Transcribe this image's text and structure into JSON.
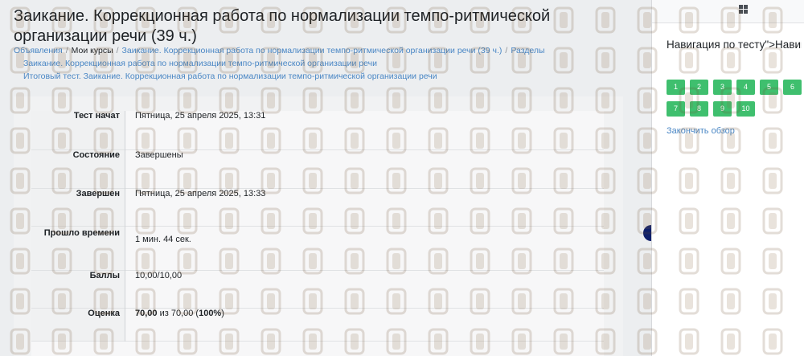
{
  "page": {
    "title": "Заикание. Коррекционная работа по нормализации темпо-ритмической организации речи (39 ч.)"
  },
  "breadcrumb": {
    "items": [
      {
        "label": "Объявления",
        "link": true
      },
      {
        "label": "Мои курсы",
        "link": false
      },
      {
        "label": "Заикание. Коррекционная работа по нормализации темпо-ритмической организации речи (39 ч.)",
        "link": true
      },
      {
        "label": "Разделы",
        "link": true
      },
      {
        "label": "Заикание. Коррекционная работа по нормализации темпо-ритмической организации речи",
        "link": true
      },
      {
        "label": "Итоговый тест. Заикание. Коррекционная работа по нормализации темпо-ритмической организации речи",
        "link": true
      }
    ]
  },
  "summary": {
    "rows": [
      {
        "label": "Тест начат",
        "value": "Пятница, 25 апреля 2025, 13:31"
      },
      {
        "label": "Состояние",
        "value": "Завершены"
      },
      {
        "label": "Завершен",
        "value": "Пятница, 25 апреля 2025, 13:33"
      },
      {
        "label": "Прошло времени",
        "value": "1 мин. 44 сек."
      },
      {
        "label": "Баллы",
        "value": "10,00/10,00"
      },
      {
        "label": "Оценка",
        "value_bold_1": "70,00",
        "value_mid": " из 70,00 (",
        "value_bold_2": "100%",
        "value_end": ")"
      }
    ]
  },
  "quiz_nav": {
    "title": "Навигация по тесту\">Навигация по тесту",
    "questions": [
      "1",
      "2",
      "3",
      "4",
      "5",
      "6",
      "7",
      "8",
      "9",
      "10"
    ],
    "finish_review": "Закончить обзор",
    "answered_color": "#3fbf6e"
  },
  "icons": {
    "drawer_toggle": "grid-icon"
  },
  "colors": {
    "link": "#4a87c5",
    "accent_dot": "#0f1f6b"
  }
}
